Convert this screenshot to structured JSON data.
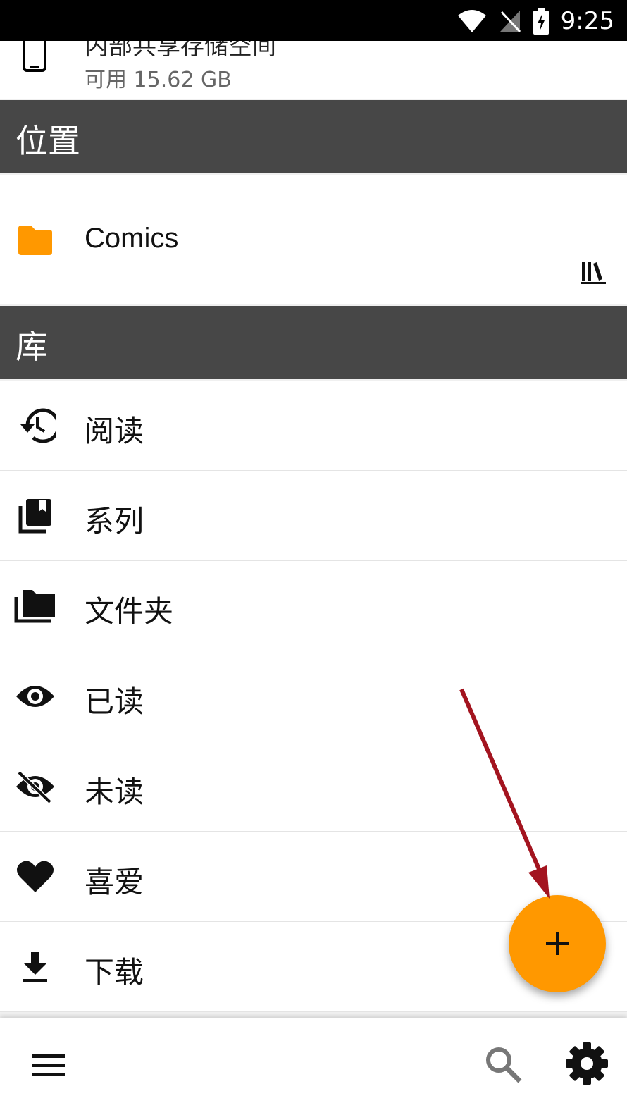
{
  "status_bar": {
    "time": "9:25"
  },
  "storage": {
    "title": "内部共享存储空间",
    "available": "可用 15.62 GB"
  },
  "locations": {
    "header": "位置",
    "items": [
      {
        "label": "Comics"
      }
    ]
  },
  "library": {
    "header": "库",
    "items": [
      {
        "label": "阅读",
        "icon": "history-icon"
      },
      {
        "label": "系列",
        "icon": "collections-bookmark-icon"
      },
      {
        "label": "文件夹",
        "icon": "folders-icon"
      },
      {
        "label": "已读",
        "icon": "eye-icon"
      },
      {
        "label": "未读",
        "icon": "eye-off-icon"
      },
      {
        "label": "喜爱",
        "icon": "heart-icon"
      },
      {
        "label": "下载",
        "icon": "download-icon"
      }
    ]
  },
  "fab": {
    "label": "+"
  },
  "colors": {
    "accent": "#ff9800",
    "header": "#474747",
    "arrow": "#a3141f"
  }
}
